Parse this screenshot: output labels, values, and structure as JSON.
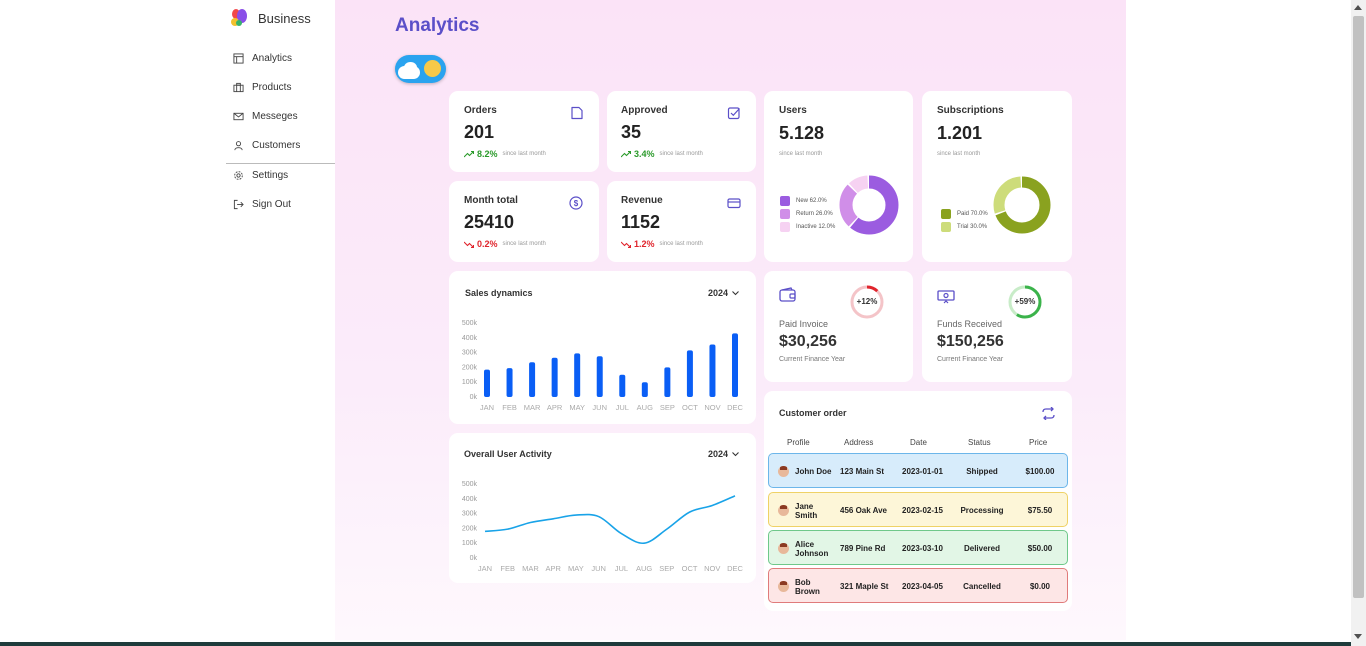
{
  "brand": {
    "name": "Business"
  },
  "sidebar": {
    "items": [
      {
        "label": "Analytics",
        "icon": "layout-icon"
      },
      {
        "label": "Products",
        "icon": "briefcase-icon"
      },
      {
        "label": "Messeges",
        "icon": "mail-icon"
      },
      {
        "label": "Customers",
        "icon": "user-icon"
      }
    ],
    "bottom_items": [
      {
        "label": "Settings",
        "icon": "gear-icon"
      },
      {
        "label": "Sign Out",
        "icon": "logout-icon"
      }
    ]
  },
  "page": {
    "title": "Analytics"
  },
  "colors": {
    "accent": "#5b4fc8",
    "up": "#2a9a2a",
    "down": "#e0242c",
    "bar": "#0a5ef5",
    "line": "#19a3e8"
  },
  "stats": {
    "orders": {
      "title": "Orders",
      "value": "201",
      "delta": "8.2%",
      "trend": "up",
      "since": "since last month"
    },
    "approved": {
      "title": "Approved",
      "value": "35",
      "delta": "3.4%",
      "trend": "up",
      "since": "since last month"
    },
    "month_total": {
      "title": "Month total",
      "value": "25410",
      "delta": "0.2%",
      "trend": "down",
      "since": "since last month"
    },
    "revenue": {
      "title": "Revenue",
      "value": "1152",
      "delta": "1.2%",
      "trend": "down",
      "since": "since last month"
    }
  },
  "users": {
    "title": "Users",
    "value": "5.128",
    "since": "since last month",
    "legend": [
      {
        "label": "New 62.0%",
        "value": 62.0,
        "color": "#9b5ce0"
      },
      {
        "label": "Return 26.0%",
        "value": 26.0,
        "color": "#d08ee8"
      },
      {
        "label": "Inactive 12.0%",
        "value": 12.0,
        "color": "#f6d2f2"
      }
    ]
  },
  "subscriptions": {
    "title": "Subscriptions",
    "value": "1.201",
    "since": "since last month",
    "legend": [
      {
        "label": "Paid 70.0%",
        "value": 70.0,
        "color": "#8aa21f"
      },
      {
        "label": "Trial 30.0%",
        "value": 30.0,
        "color": "#cddc7a"
      }
    ]
  },
  "paid_invoice": {
    "badge": "+12%",
    "progress": 12,
    "label": "Paid Invoice",
    "value": "$30,256",
    "sub": "Current Finance Year"
  },
  "funds_received": {
    "badge": "+59%",
    "progress": 59,
    "label": "Funds Received",
    "value": "$150,256",
    "sub": "Current Finance Year"
  },
  "sales": {
    "title": "Sales dynamics",
    "year": "2024"
  },
  "activity": {
    "title": "Overall User Activity",
    "year": "2024"
  },
  "chart_data": [
    {
      "type": "bar",
      "title": "Sales dynamics",
      "categories": [
        "JAN",
        "FEB",
        "MAR",
        "APR",
        "MAY",
        "JUN",
        "JUL",
        "AUG",
        "SEP",
        "OCT",
        "NOV",
        "DEC"
      ],
      "values": [
        185000,
        195000,
        235000,
        265000,
        295000,
        275000,
        150000,
        100000,
        200000,
        315000,
        355000,
        430000
      ],
      "yticks": [
        "500k",
        "400k",
        "300k",
        "200k",
        "100k",
        "0k"
      ],
      "ylim": [
        0,
        500000
      ]
    },
    {
      "type": "line",
      "title": "Overall User Activity",
      "categories": [
        "JAN",
        "FEB",
        "MAR",
        "APR",
        "MAY",
        "JUN",
        "JUL",
        "AUG",
        "SEP",
        "OCT",
        "NOV",
        "DEC"
      ],
      "values": [
        180000,
        195000,
        240000,
        265000,
        290000,
        280000,
        165000,
        100000,
        195000,
        310000,
        355000,
        420000
      ],
      "yticks": [
        "500k",
        "400k",
        "300k",
        "200k",
        "100k",
        "0k"
      ],
      "ylim": [
        0,
        500000
      ]
    }
  ],
  "orders_table": {
    "title": "Customer order",
    "headers": [
      "Profile",
      "Address",
      "Date",
      "Status",
      "Price"
    ],
    "rows": [
      {
        "name": "John Doe",
        "address": "123 Main St",
        "date": "2023-01-01",
        "status": "Shipped",
        "price": "$100.00",
        "bg": "#d7ecfb",
        "border": "#6cb6ea"
      },
      {
        "name": "Jane Smith",
        "address": "456 Oak Ave",
        "date": "2023-02-15",
        "status": "Processing",
        "price": "$75.50",
        "bg": "#fdf6d8",
        "border": "#efd266"
      },
      {
        "name": "Alice Johnson",
        "address": "789 Pine Rd",
        "date": "2023-03-10",
        "status": "Delivered",
        "price": "$50.00",
        "bg": "#e2f6e6",
        "border": "#6fc88a"
      },
      {
        "name": "Bob Brown",
        "address": "321 Maple St",
        "date": "2023-04-05",
        "status": "Cancelled",
        "price": "$0.00",
        "bg": "#fde6e6",
        "border": "#e07b7b"
      }
    ]
  }
}
